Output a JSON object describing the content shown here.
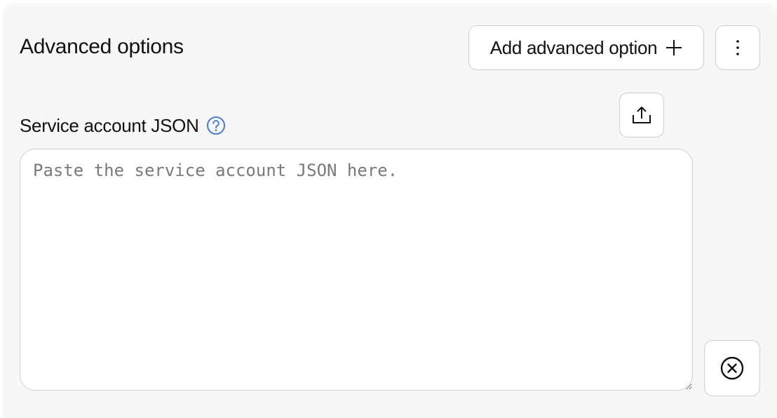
{
  "header": {
    "title": "Advanced options",
    "add_button_label": "Add advanced option"
  },
  "field": {
    "label": "Service account JSON",
    "placeholder": "Paste the service account JSON here.",
    "value": ""
  },
  "icons": {
    "add": "plus-icon",
    "more": "kebab-menu-icon",
    "help": "help-circle-icon",
    "upload": "upload-icon",
    "clear": "close-circle-icon"
  },
  "colors": {
    "accent": "#4a7ddb",
    "panel_background": "#f7f7f7",
    "border": "#cfcfcf",
    "placeholder": "#7a7a7a"
  }
}
